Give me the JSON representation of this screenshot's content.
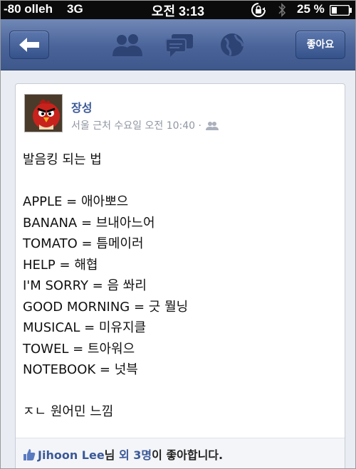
{
  "status_bar": {
    "carrier": "-80 olleh",
    "network": "3G",
    "time": "오전 3:13",
    "battery": "25 %"
  },
  "nav_bar": {
    "back_icon": "left-arrow-icon",
    "icons": [
      "friends-icon",
      "messages-icon",
      "globe-icon"
    ],
    "like_button_label": "좋아요"
  },
  "post": {
    "author": "장성",
    "meta": "서울 근처 수요일 오전 10:40 ·",
    "privacy_icon": "friends-privacy-icon",
    "title": "발음킹 되는 법",
    "lines": [
      "APPLE = 애아뽀으",
      "BANANA = 브내아느어",
      "TOMATO = 틈메이러",
      "HELP = 해협",
      "I'M SORRY = 음 쏴리",
      "GOOD MORNING = 긋 뭘닝",
      "MUSICAL = 미유지클",
      "TOWEL = 트아워으",
      "NOTEBOOK = 넛븍"
    ],
    "closing": "ㅈㄴ 원어민 느낌"
  },
  "likes": {
    "name": "Jihoon Lee",
    "suffix": "님 ",
    "others": "외 3명",
    "tail": "이 좋아합니다."
  }
}
